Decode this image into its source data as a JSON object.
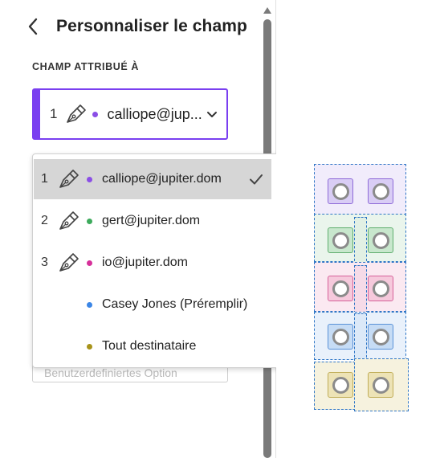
{
  "panel": {
    "title": "Personnaliser le champ",
    "section_label": "CHAMP ATTRIBUÉ À",
    "assigned": {
      "number": "1",
      "email": "calliope@jup...",
      "dot_color": "#8b4ee6"
    },
    "hidden_field_text": "Benutzerdefiniertes Option"
  },
  "dropdown": {
    "options": [
      {
        "number": "1",
        "label": "calliope@jupiter.dom",
        "dot_color": "#8b4ee6",
        "signer": true,
        "selected": true
      },
      {
        "number": "2",
        "label": "gert@jupiter.dom",
        "dot_color": "#3daa5c",
        "signer": true,
        "selected": false
      },
      {
        "number": "3",
        "label": "io@jupiter.dom",
        "dot_color": "#d6309a",
        "signer": true,
        "selected": false
      },
      {
        "number": "",
        "label": "Casey Jones (Préremplir)",
        "dot_color": "#3b86e6",
        "signer": false,
        "selected": false
      },
      {
        "number": "",
        "label": "Tout destinataire",
        "dot_color": "#a8931a",
        "signer": false,
        "selected": false
      }
    ]
  },
  "icons": {
    "back": "chevron-left-icon",
    "pen": "signature-pen-icon",
    "chevron": "chevron-down-icon",
    "check": "checkmark-icon"
  },
  "colors": {
    "accent": "#7a3ff0",
    "purple_fill": "#f1ecfb",
    "green_fill": "#eaf5ec",
    "pink_fill": "#fbe9f1",
    "blue_fill": "#e9f1fb",
    "olive_fill": "#f6f2de"
  }
}
